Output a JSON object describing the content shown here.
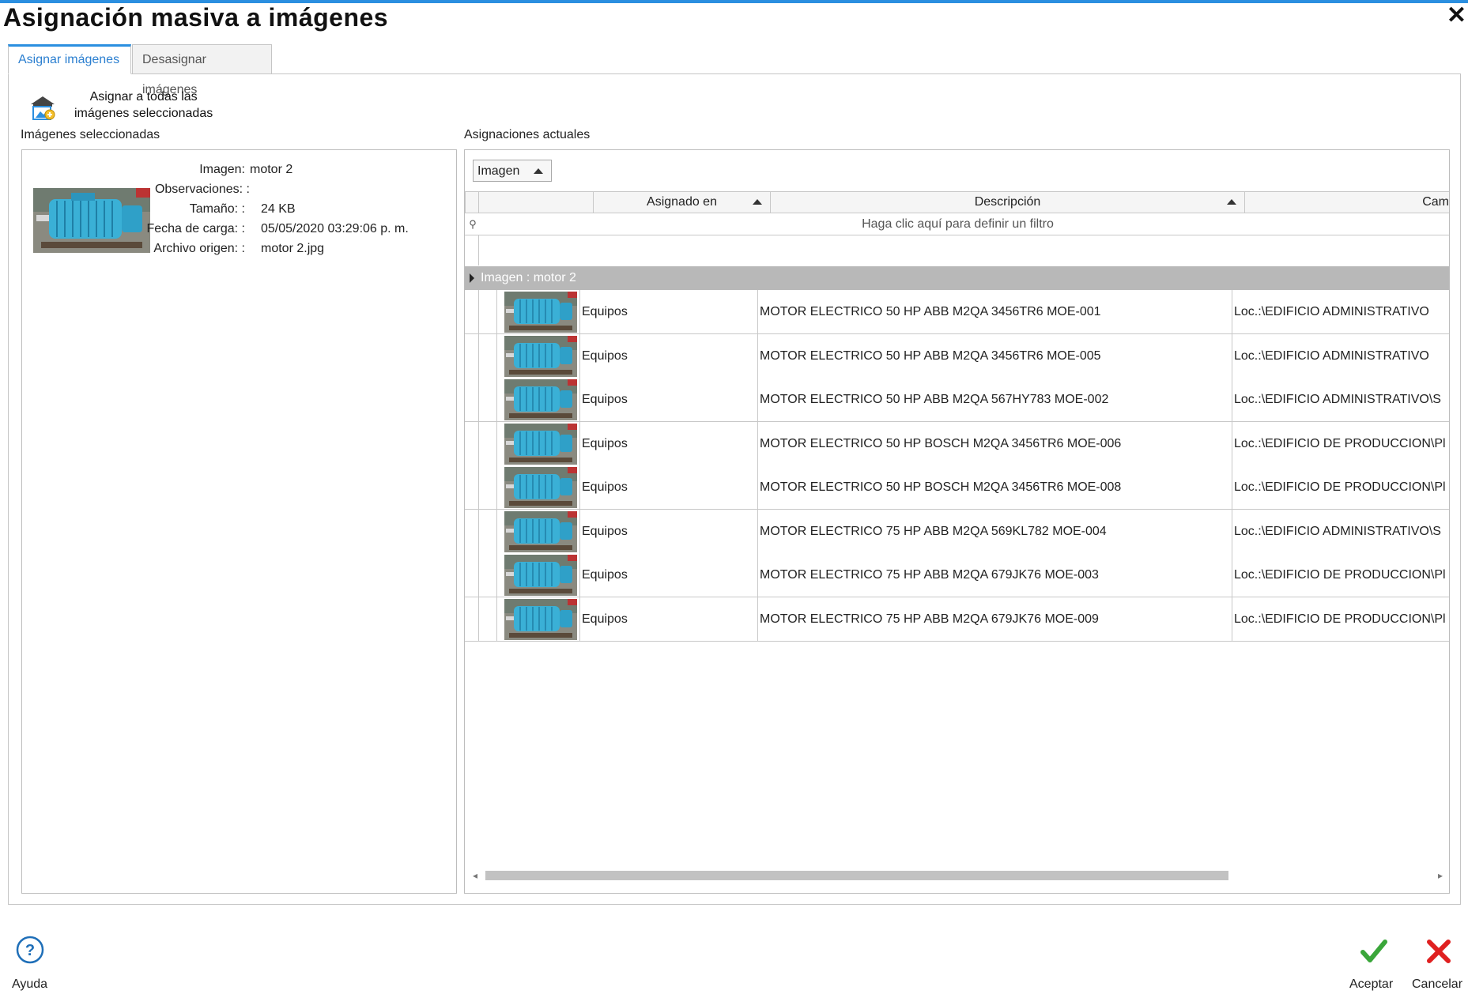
{
  "window": {
    "title": "Asignación masiva a imágenes",
    "close_glyph": "✕"
  },
  "tabs": [
    {
      "label": "Asignar imágenes",
      "active": true
    },
    {
      "label": "Desasignar imágenes",
      "active": false
    }
  ],
  "toolbar": {
    "assign_all_line1": "Asignar a todas las",
    "assign_all_line2": "imágenes seleccionadas",
    "assign_all_icon": "assign-images-icon"
  },
  "left_panel": {
    "label": "Imágenes seleccionadas",
    "image": {
      "thumbnail_icon": "motor-thumbnail",
      "fields": [
        {
          "key": "Imagen:",
          "value": "motor 2"
        },
        {
          "key": "Observaciones: :",
          "value": ""
        },
        {
          "key": "Tamaño: :",
          "value": "24 KB"
        },
        {
          "key": "Fecha de carga: :",
          "value": "05/05/2020 03:29:06 p. m."
        },
        {
          "key": "Archivo origen: :",
          "value": "motor 2.jpg"
        }
      ]
    }
  },
  "right_panel": {
    "label": "Asignaciones actuales",
    "group_by_chip": "Imagen",
    "columns": {
      "asignado": "Asignado en",
      "descripcion": "Descripción",
      "campo": "Cam"
    },
    "filter_text": "Haga clic aquí para definir un filtro",
    "filter_icon": "filter-pin-icon",
    "group_row": "Imagen : motor 2",
    "rows": [
      {
        "asignado": "Equipos",
        "descripcion": "MOTOR ELECTRICO 50 HP ABB M2QA 3456TR6 MOE-001",
        "campo": "Loc.:\\EDIFICIO ADMINISTRATIVO"
      },
      {
        "asignado": "Equipos",
        "descripcion": "MOTOR ELECTRICO 50 HP ABB M2QA 3456TR6 MOE-005",
        "campo": "Loc.:\\EDIFICIO ADMINISTRATIVO"
      },
      {
        "asignado": "Equipos",
        "descripcion": "MOTOR ELECTRICO 50 HP ABB M2QA 567HY783 MOE-002",
        "campo": "Loc.:\\EDIFICIO ADMINISTRATIVO\\S"
      },
      {
        "asignado": "Equipos",
        "descripcion": "MOTOR ELECTRICO 50 HP BOSCH M2QA 3456TR6 MOE-006",
        "campo": "Loc.:\\EDIFICIO DE PRODUCCION\\Pl"
      },
      {
        "asignado": "Equipos",
        "descripcion": "MOTOR ELECTRICO 50 HP BOSCH M2QA 3456TR6 MOE-008",
        "campo": "Loc.:\\EDIFICIO DE PRODUCCION\\Pl"
      },
      {
        "asignado": "Equipos",
        "descripcion": "MOTOR ELECTRICO 75 HP ABB M2QA 569KL782 MOE-004",
        "campo": "Loc.:\\EDIFICIO ADMINISTRATIVO\\S"
      },
      {
        "asignado": "Equipos",
        "descripcion": "MOTOR ELECTRICO 75 HP ABB M2QA 679JK76 MOE-003",
        "campo": "Loc.:\\EDIFICIO DE PRODUCCION\\Pl"
      },
      {
        "asignado": "Equipos",
        "descripcion": "MOTOR ELECTRICO 75 HP ABB M2QA 679JK76 MOE-009",
        "campo": "Loc.:\\EDIFICIO DE PRODUCCION\\Pl"
      }
    ]
  },
  "footer": {
    "help_label": "Ayuda",
    "accept_label": "Aceptar",
    "cancel_label": "Cancelar",
    "help_icon": "help-circle-icon",
    "accept_icon": "check-icon",
    "cancel_icon": "x-icon"
  },
  "colors": {
    "accent": "#2b8fe0",
    "motor_blue": "#3ab0d6",
    "accept_green": "#3aa63a",
    "cancel_red": "#e02020",
    "group_row": "#b8b8b8"
  }
}
